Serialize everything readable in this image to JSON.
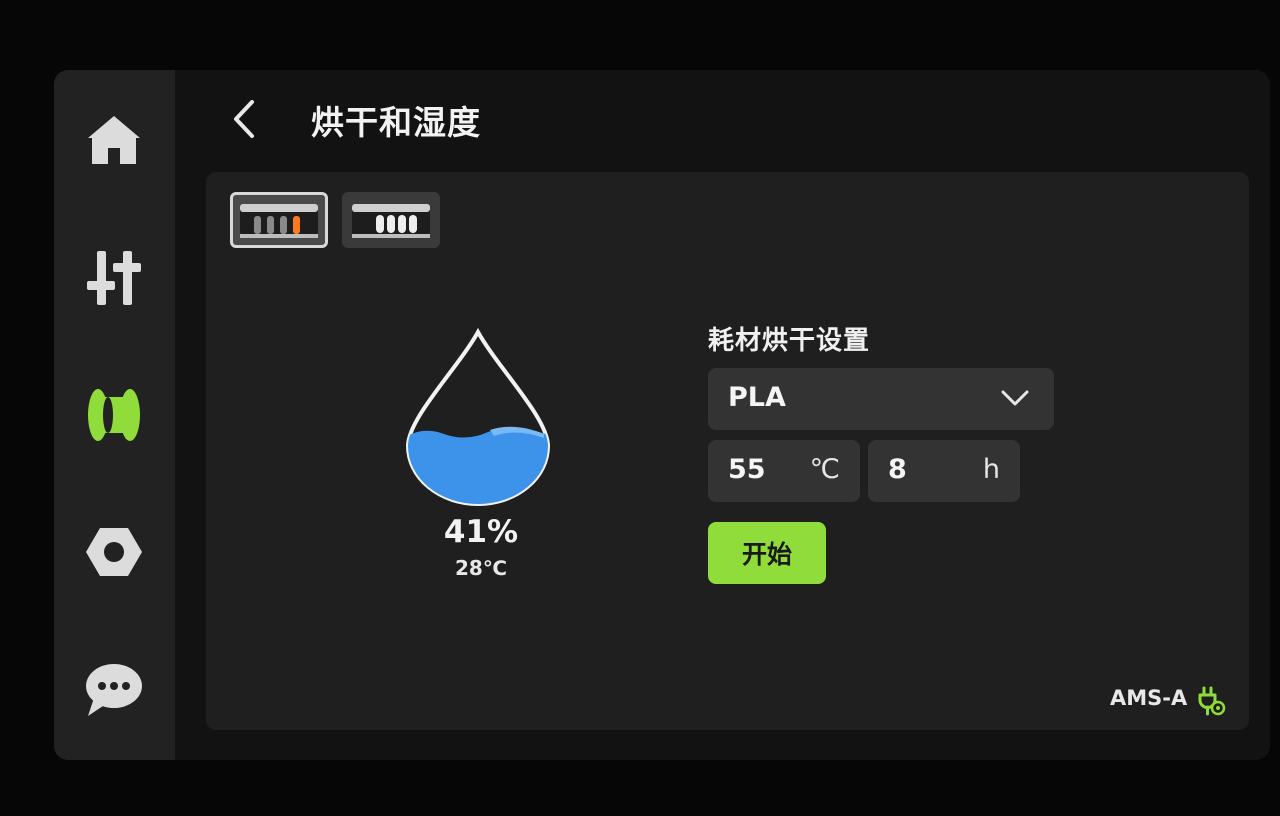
{
  "header": {
    "title": "烘干和湿度"
  },
  "sidebar": {
    "items": [
      {
        "name": "home",
        "icon": "home-icon",
        "active": false
      },
      {
        "name": "controls",
        "icon": "sliders-icon",
        "active": false
      },
      {
        "name": "filament",
        "icon": "spool-icon",
        "active": true
      },
      {
        "name": "settings",
        "icon": "hex-nut-icon",
        "active": false
      },
      {
        "name": "messages",
        "icon": "chat-bubble-icon",
        "active": false
      }
    ]
  },
  "units": [
    {
      "icon": "ams-unit-icon",
      "selected": true
    },
    {
      "icon": "ams-lite-unit-icon",
      "selected": false
    }
  ],
  "humidity": {
    "value": "41%",
    "temperature": "28℃",
    "level": 0.41
  },
  "drying": {
    "title": "耗材烘干设置",
    "material": "PLA",
    "temperature": "55",
    "temperature_unit": "℃",
    "time": "8",
    "time_unit": "h",
    "start_label": "开始"
  },
  "status": {
    "unit_name": "AMS-A",
    "icon": "power-plug-icon"
  },
  "colors": {
    "accent": "#8fdc3a",
    "water": "#3d92ea",
    "highlight_slot": "#ff7a1a",
    "annotation_arrow": "#ff2a2a"
  }
}
